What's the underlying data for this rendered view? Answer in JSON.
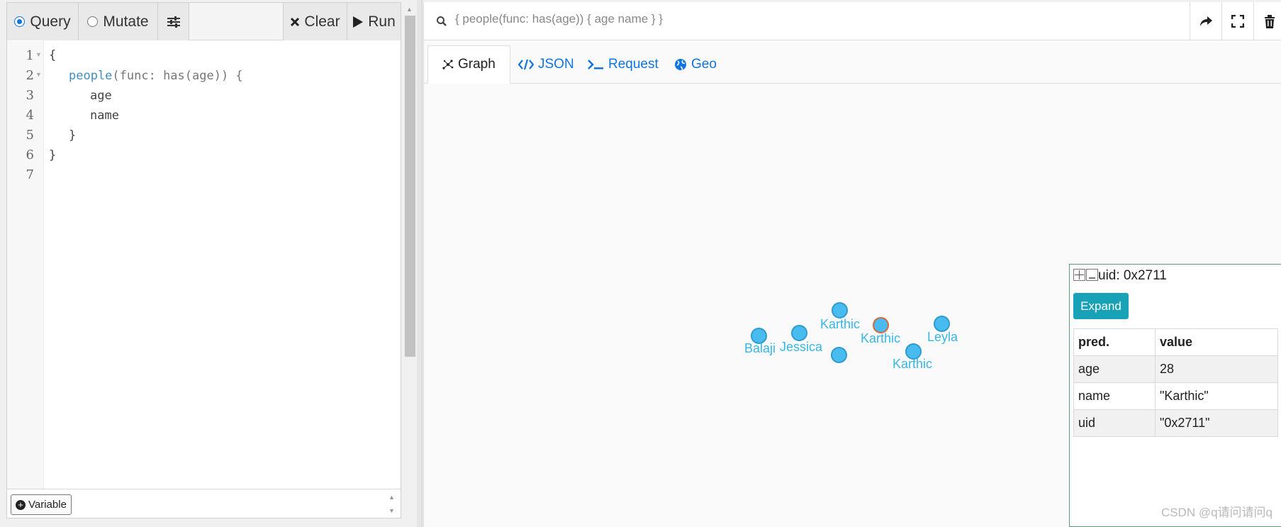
{
  "toolbar": {
    "query_label": "Query",
    "mutate_label": "Mutate",
    "clear_label": "Clear",
    "run_label": "Run",
    "selected_mode": "Query"
  },
  "editor": {
    "line_numbers": [
      "1",
      "2",
      "3",
      "4",
      "5",
      "6",
      "7"
    ],
    "lines": {
      "l1": "{",
      "l2_fn": "people",
      "l2_rest": "(func: has(age)) {",
      "l3": "age",
      "l4": "name",
      "l5": "}",
      "l6": "}"
    }
  },
  "variable_button": "Variable",
  "query_bar": {
    "text": "{ people(func: has(age)) { age name } }",
    "icons": [
      "search-icon",
      "share-icon",
      "fullscreen-icon",
      "trash-icon"
    ]
  },
  "tabs": {
    "graph": "Graph",
    "json": "JSON",
    "request": "Request",
    "geo": "Geo",
    "active": "Graph"
  },
  "graph": {
    "nodes": [
      {
        "label": "Balaji"
      },
      {
        "label": "Jessica"
      },
      {
        "label": "Karthic"
      },
      {
        "label": ""
      },
      {
        "label": "Karthic",
        "selected": true
      },
      {
        "label": "Karthic"
      },
      {
        "label": "Leyla"
      }
    ],
    "node_color": "#48bcee",
    "selected_ring_color": "#d9663b"
  },
  "popup": {
    "title": "uid: 0x2711",
    "expand_label": "Expand",
    "headers": {
      "pred": "pred.",
      "value": "value"
    },
    "rows": [
      {
        "pred": "age",
        "value": "28"
      },
      {
        "pred": "name",
        "value": "\"Karthic\""
      },
      {
        "pred": "uid",
        "value": "\"0x2711\""
      }
    ]
  },
  "watermark": "CSDN @q请问请问q"
}
